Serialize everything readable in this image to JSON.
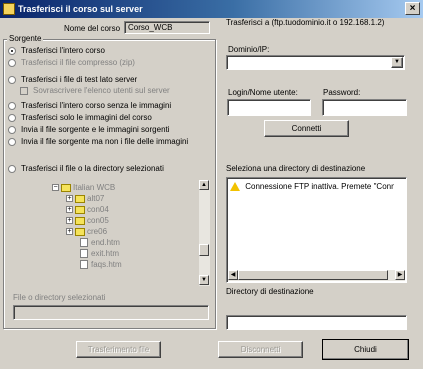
{
  "window": {
    "title": "Trasferisci il corso sul server",
    "close_glyph": "×"
  },
  "course": {
    "label": "Nome del corso",
    "value": "Corso_WCB"
  },
  "source": {
    "legend": "Sorgente",
    "options": [
      {
        "label": "Trasferisci l'intero corso",
        "selected": true,
        "enabled": true
      },
      {
        "label": "Trasferisci il file compresso (zip)",
        "selected": false,
        "enabled": false
      },
      {
        "label": "Trasferisci i file di test lato server",
        "selected": false,
        "enabled": true
      },
      {
        "label": "Sovrascrivere l'elenco utenti sul server",
        "selected": false,
        "enabled": false,
        "checkbox": true
      },
      {
        "label": "Trasferisci l'intero corso senza le immagini",
        "selected": false,
        "enabled": true
      },
      {
        "label": "Trasferisci solo le immagini del corso",
        "selected": false,
        "enabled": true
      },
      {
        "label": "Invia il file sorgente e le immagini sorgenti",
        "selected": false,
        "enabled": true
      },
      {
        "label": "Invia il file sorgente ma non i file delle immagini",
        "selected": false,
        "enabled": true
      },
      {
        "label": "Trasferisci il file o la directory selezionati",
        "selected": false,
        "enabled": true
      }
    ],
    "tree": [
      {
        "kind": "folder",
        "label": "Italian WCB",
        "toggle": "−",
        "level": 0
      },
      {
        "kind": "folder",
        "label": "alt07",
        "toggle": "+",
        "level": 1
      },
      {
        "kind": "folder",
        "label": "con04",
        "toggle": "+",
        "level": 1
      },
      {
        "kind": "folder",
        "label": "con05",
        "toggle": "+",
        "level": 1
      },
      {
        "kind": "folder",
        "label": "cre06",
        "toggle": "+",
        "level": 1
      },
      {
        "kind": "file",
        "label": "end.htm",
        "level": 1
      },
      {
        "kind": "file",
        "label": "exit.htm",
        "level": 1
      },
      {
        "kind": "file",
        "label": "faqs.htm",
        "level": 1
      }
    ],
    "selected_label": "File o directory selezionati",
    "selected_value": ""
  },
  "ftp": {
    "server_label": "Trasferisci a (ftp.tuodominio.it o 192.168.1.2)",
    "domain_label": "Dominio/IP:",
    "domain_value": "",
    "login_label": "Login/Nome utente:",
    "login_value": "",
    "password_label": "Password:",
    "password_value": "",
    "connect_label": "Connetti",
    "dest_select_label": "Seleziona una directory di destinazione",
    "message": "Connessione FTP inattiva.  Premete \"Connetti\" p",
    "dest_label": "Directory di destinazione",
    "dest_value": ""
  },
  "buttons": {
    "transfer_label": "Trasferimento file",
    "disconnect_label": "Disconnetti",
    "close_label": "Chiudi"
  },
  "icons": {
    "app": "folder-upload-icon",
    "warning": "warning-icon",
    "dropdown": "chevron-down-icon"
  },
  "colors": {
    "titlebar_start": "#0a246a",
    "titlebar_end": "#a6caf0",
    "warning": "#f2c200"
  }
}
